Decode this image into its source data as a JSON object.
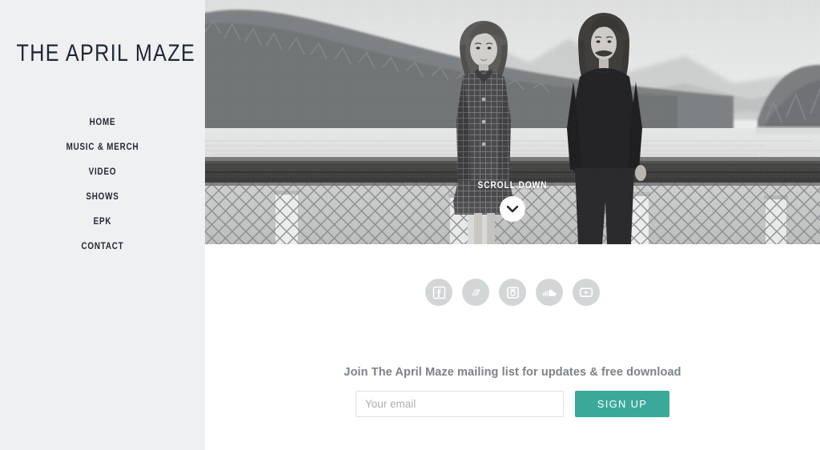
{
  "sidebar": {
    "brand": "THE APRIL MAZE",
    "nav": [
      {
        "label": "HOME"
      },
      {
        "label": "MUSIC & MERCH"
      },
      {
        "label": "VIDEO"
      },
      {
        "label": "SHOWS"
      },
      {
        "label": "EPK"
      },
      {
        "label": "CONTACT"
      }
    ],
    "background_color": "#eff0f2",
    "text_color": "#1e2733"
  },
  "hero": {
    "description": "Black and white photograph of a woman in a checked coat and a man in a dark sweater standing in front of a chain-link fence above a lake with forested hills",
    "scroll_label": "SCROLL DOWN",
    "scroll_icon": "chevron-down-icon"
  },
  "socials": [
    {
      "name": "facebook",
      "icon": "facebook-icon"
    },
    {
      "name": "bandcamp",
      "icon": "bandcamp-icon"
    },
    {
      "name": "instagram",
      "icon": "instagram-icon"
    },
    {
      "name": "soundcloud",
      "icon": "soundcloud-icon"
    },
    {
      "name": "youtube",
      "icon": "youtube-icon"
    }
  ],
  "mailing": {
    "title": "Join The April Maze mailing list for updates & free download",
    "email_value": "",
    "email_placeholder": "Your email",
    "signup_label": "SIGN UP",
    "accent_color": "#3aa99a",
    "title_color": "#7b8289"
  }
}
